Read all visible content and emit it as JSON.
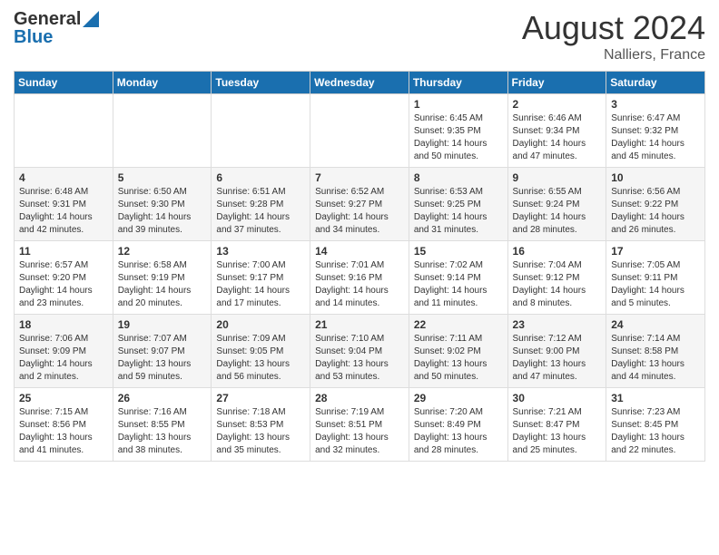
{
  "header": {
    "logo_general": "General",
    "logo_blue": "Blue",
    "month_year": "August 2024",
    "location": "Nalliers, France"
  },
  "days_of_week": [
    "Sunday",
    "Monday",
    "Tuesday",
    "Wednesday",
    "Thursday",
    "Friday",
    "Saturday"
  ],
  "weeks": [
    [
      {
        "day": "",
        "info": ""
      },
      {
        "day": "",
        "info": ""
      },
      {
        "day": "",
        "info": ""
      },
      {
        "day": "",
        "info": ""
      },
      {
        "day": "1",
        "info": "Sunrise: 6:45 AM\nSunset: 9:35 PM\nDaylight: 14 hours\nand 50 minutes."
      },
      {
        "day": "2",
        "info": "Sunrise: 6:46 AM\nSunset: 9:34 PM\nDaylight: 14 hours\nand 47 minutes."
      },
      {
        "day": "3",
        "info": "Sunrise: 6:47 AM\nSunset: 9:32 PM\nDaylight: 14 hours\nand 45 minutes."
      }
    ],
    [
      {
        "day": "4",
        "info": "Sunrise: 6:48 AM\nSunset: 9:31 PM\nDaylight: 14 hours\nand 42 minutes."
      },
      {
        "day": "5",
        "info": "Sunrise: 6:50 AM\nSunset: 9:30 PM\nDaylight: 14 hours\nand 39 minutes."
      },
      {
        "day": "6",
        "info": "Sunrise: 6:51 AM\nSunset: 9:28 PM\nDaylight: 14 hours\nand 37 minutes."
      },
      {
        "day": "7",
        "info": "Sunrise: 6:52 AM\nSunset: 9:27 PM\nDaylight: 14 hours\nand 34 minutes."
      },
      {
        "day": "8",
        "info": "Sunrise: 6:53 AM\nSunset: 9:25 PM\nDaylight: 14 hours\nand 31 minutes."
      },
      {
        "day": "9",
        "info": "Sunrise: 6:55 AM\nSunset: 9:24 PM\nDaylight: 14 hours\nand 28 minutes."
      },
      {
        "day": "10",
        "info": "Sunrise: 6:56 AM\nSunset: 9:22 PM\nDaylight: 14 hours\nand 26 minutes."
      }
    ],
    [
      {
        "day": "11",
        "info": "Sunrise: 6:57 AM\nSunset: 9:20 PM\nDaylight: 14 hours\nand 23 minutes."
      },
      {
        "day": "12",
        "info": "Sunrise: 6:58 AM\nSunset: 9:19 PM\nDaylight: 14 hours\nand 20 minutes."
      },
      {
        "day": "13",
        "info": "Sunrise: 7:00 AM\nSunset: 9:17 PM\nDaylight: 14 hours\nand 17 minutes."
      },
      {
        "day": "14",
        "info": "Sunrise: 7:01 AM\nSunset: 9:16 PM\nDaylight: 14 hours\nand 14 minutes."
      },
      {
        "day": "15",
        "info": "Sunrise: 7:02 AM\nSunset: 9:14 PM\nDaylight: 14 hours\nand 11 minutes."
      },
      {
        "day": "16",
        "info": "Sunrise: 7:04 AM\nSunset: 9:12 PM\nDaylight: 14 hours\nand 8 minutes."
      },
      {
        "day": "17",
        "info": "Sunrise: 7:05 AM\nSunset: 9:11 PM\nDaylight: 14 hours\nand 5 minutes."
      }
    ],
    [
      {
        "day": "18",
        "info": "Sunrise: 7:06 AM\nSunset: 9:09 PM\nDaylight: 14 hours\nand 2 minutes."
      },
      {
        "day": "19",
        "info": "Sunrise: 7:07 AM\nSunset: 9:07 PM\nDaylight: 13 hours\nand 59 minutes."
      },
      {
        "day": "20",
        "info": "Sunrise: 7:09 AM\nSunset: 9:05 PM\nDaylight: 13 hours\nand 56 minutes."
      },
      {
        "day": "21",
        "info": "Sunrise: 7:10 AM\nSunset: 9:04 PM\nDaylight: 13 hours\nand 53 minutes."
      },
      {
        "day": "22",
        "info": "Sunrise: 7:11 AM\nSunset: 9:02 PM\nDaylight: 13 hours\nand 50 minutes."
      },
      {
        "day": "23",
        "info": "Sunrise: 7:12 AM\nSunset: 9:00 PM\nDaylight: 13 hours\nand 47 minutes."
      },
      {
        "day": "24",
        "info": "Sunrise: 7:14 AM\nSunset: 8:58 PM\nDaylight: 13 hours\nand 44 minutes."
      }
    ],
    [
      {
        "day": "25",
        "info": "Sunrise: 7:15 AM\nSunset: 8:56 PM\nDaylight: 13 hours\nand 41 minutes."
      },
      {
        "day": "26",
        "info": "Sunrise: 7:16 AM\nSunset: 8:55 PM\nDaylight: 13 hours\nand 38 minutes."
      },
      {
        "day": "27",
        "info": "Sunrise: 7:18 AM\nSunset: 8:53 PM\nDaylight: 13 hours\nand 35 minutes."
      },
      {
        "day": "28",
        "info": "Sunrise: 7:19 AM\nSunset: 8:51 PM\nDaylight: 13 hours\nand 32 minutes."
      },
      {
        "day": "29",
        "info": "Sunrise: 7:20 AM\nSunset: 8:49 PM\nDaylight: 13 hours\nand 28 minutes."
      },
      {
        "day": "30",
        "info": "Sunrise: 7:21 AM\nSunset: 8:47 PM\nDaylight: 13 hours\nand 25 minutes."
      },
      {
        "day": "31",
        "info": "Sunrise: 7:23 AM\nSunset: 8:45 PM\nDaylight: 13 hours\nand 22 minutes."
      }
    ]
  ]
}
